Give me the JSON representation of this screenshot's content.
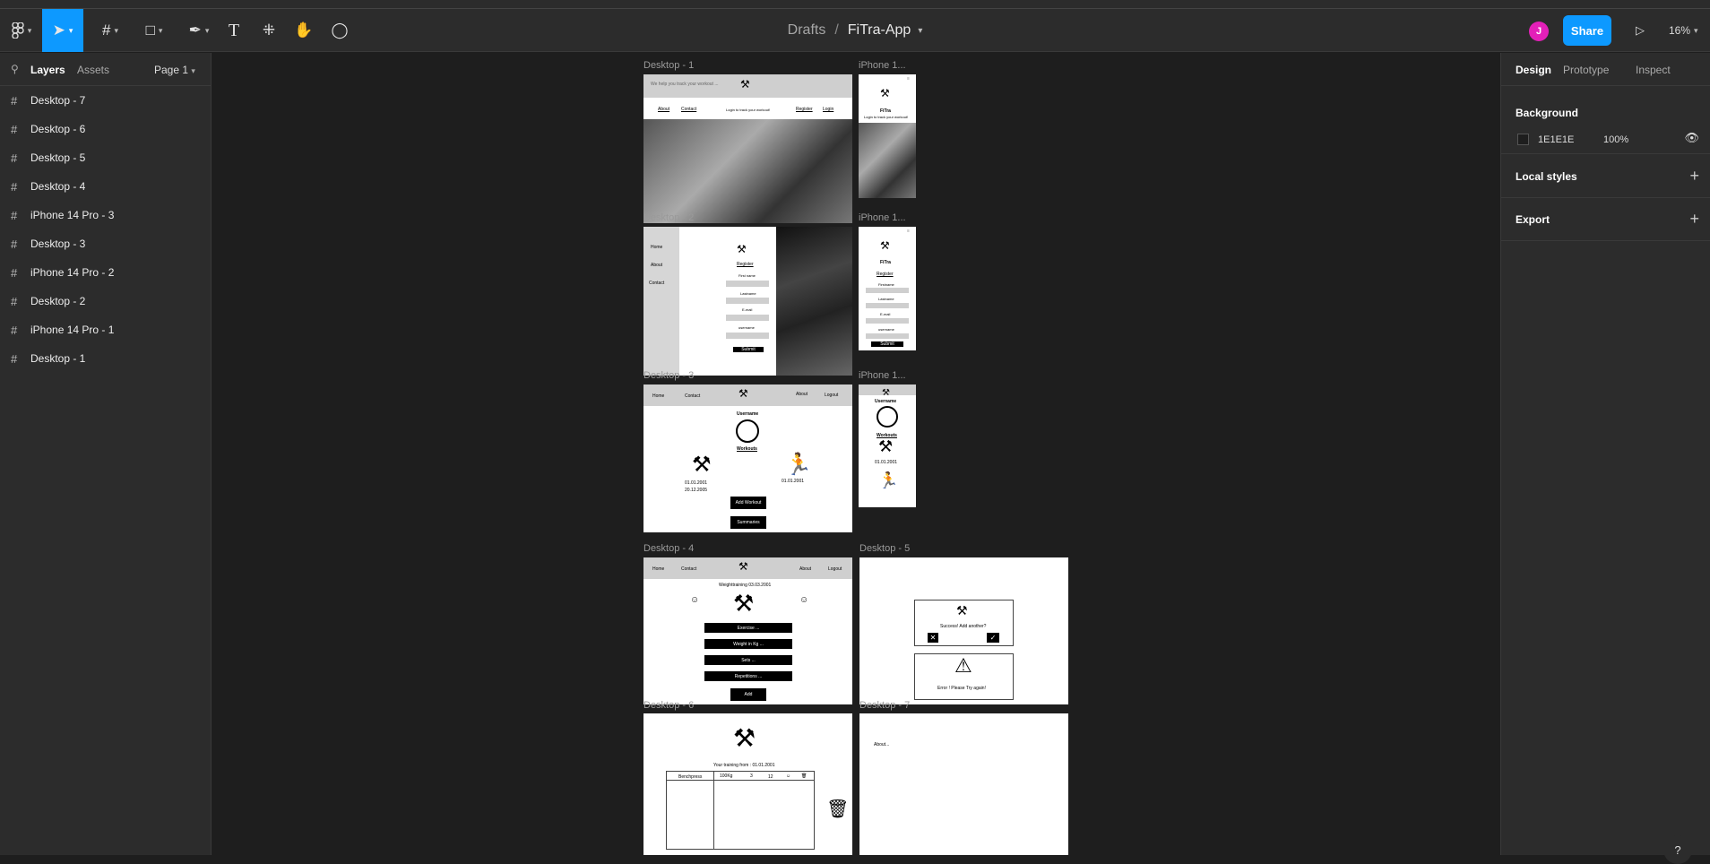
{
  "toolbar": {
    "breadcrumb_drafts": "Drafts",
    "breadcrumb_sep": "/",
    "file_name": "FiTra-App",
    "avatar_initial": "J",
    "share_label": "Share",
    "zoom": "16%"
  },
  "left_panel": {
    "tab_layers": "Layers",
    "tab_assets": "Assets",
    "page": "Page 1",
    "layers": [
      "Desktop - 7",
      "Desktop - 6",
      "Desktop - 5",
      "Desktop - 4",
      "iPhone 14 Pro - 3",
      "Desktop - 3",
      "iPhone 14 Pro - 2",
      "Desktop - 2",
      "iPhone 14 Pro - 1",
      "Desktop - 1"
    ]
  },
  "right_panel": {
    "tab_design": "Design",
    "tab_prototype": "Prototype",
    "tab_inspect": "Inspect",
    "background_title": "Background",
    "background_hex": "1E1E1E",
    "background_opacity": "100%",
    "local_styles_title": "Local styles",
    "export_title": "Export"
  },
  "colors": {
    "accent": "#0d99ff",
    "avatar": "#e320b8",
    "panel": "#2c2c2c",
    "canvas": "#1e1e1e"
  },
  "canvas": {
    "frame_labels": {
      "desktop1": "Desktop - 1",
      "iphone1": "iPhone 1...",
      "desktop2": "Desktop - 2",
      "iphone2": "iPhone 1...",
      "desktop3": "Desktop - 3",
      "iphone3": "iPhone 1...",
      "desktop4": "Desktop - 4",
      "desktop5": "Desktop - 5",
      "desktop6": "Desktop - 6",
      "desktop7": "Desktop - 7"
    },
    "d1": {
      "header_text": "We help you track your workout ...",
      "nav_about": "About",
      "nav_contact": "Contact",
      "tagline": "Login to track your workout!",
      "nav_register": "Register",
      "nav_login": "Login"
    },
    "i1": {
      "brand": "FiTra",
      "tagline": "Login to track your workout!"
    },
    "d2": {
      "nav_home": "Home",
      "nav_about": "About",
      "nav_contact": "Contact",
      "title": "Register",
      "f1": "First name",
      "f2": "Lastname",
      "f3": "E-mail",
      "f4": "username",
      "submit": "Submit"
    },
    "i2": {
      "brand": "FiTra",
      "title": "Register",
      "f1": "Firstname",
      "f2": "Lastname",
      "f3": "E-mail",
      "f4": "username",
      "submit": "Submit"
    },
    "d3": {
      "nav_home": "Home",
      "nav_contact": "Contact",
      "nav_about": "About",
      "nav_logout": "Logout",
      "username": "Username",
      "workouts": "Workouts",
      "date1": "01.01.2001",
      "date2": "20.12.2005",
      "date3": "01.01.2001",
      "add_workout": "Add Workout",
      "summaries": "Summaries"
    },
    "i3": {
      "username": "Username",
      "workouts": "Workouts",
      "date1": "01.01.2001"
    },
    "d4": {
      "nav_home": "Home",
      "nav_contact": "Contact",
      "nav_about": "About",
      "nav_logout": "Logout",
      "title": "Weighttraining 03.03.2001",
      "exercise": "Exercise ...",
      "weight": "Weight in Kg ...",
      "sets": "Sets ...",
      "reps": "Repetitions ...",
      "add": "Add"
    },
    "d5": {
      "success": "Success! Add another?",
      "error": "Error ! Please Try again!"
    },
    "d6": {
      "title": "Your training from : 01.01.2001",
      "row_name": "Benchpress",
      "row_weight": "100Kg",
      "row_sets": "3",
      "row_reps": "12"
    },
    "d7": {
      "text": "About..."
    }
  }
}
